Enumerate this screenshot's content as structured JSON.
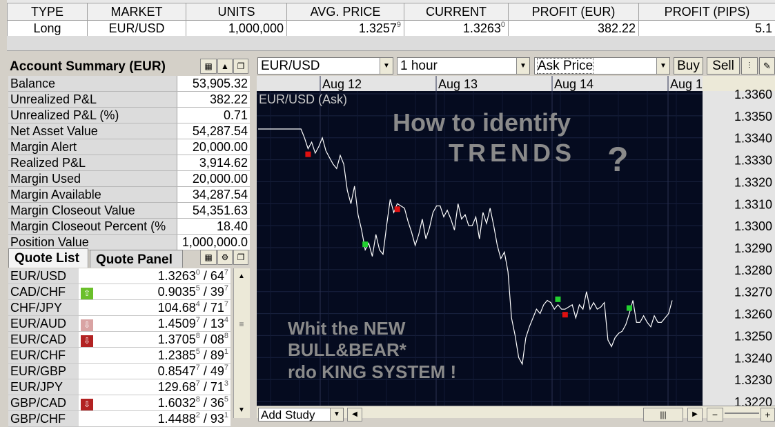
{
  "positions": {
    "headers": [
      "TYPE",
      "MARKET",
      "UNITS",
      "AVG. PRICE",
      "CURRENT",
      "PROFIT (EUR)",
      "PROFIT (PIPS)"
    ],
    "row": {
      "type": "Long",
      "market": "EUR/USD",
      "units": "1,000,000",
      "avg_price_main": "1.3257",
      "avg_price_sup": "9",
      "current_main": "1.3263",
      "current_sup": "0",
      "profit_eur": "382.22",
      "profit_pips": "5.1"
    }
  },
  "account_summary": {
    "title": "Account Summary (EUR)",
    "rows": [
      {
        "label": "Balance",
        "value": "53,905.32"
      },
      {
        "label": "Unrealized P&L",
        "value": "382.22"
      },
      {
        "label": "Unrealized P&L (%)",
        "value": "0.71"
      },
      {
        "label": "Net Asset Value",
        "value": "54,287.54"
      },
      {
        "label": "Margin Alert",
        "value": "20,000.00"
      },
      {
        "label": "Realized P&L",
        "value": "3,914.62"
      },
      {
        "label": "Margin Used",
        "value": "20,000.00"
      },
      {
        "label": "Margin Available",
        "value": "34,287.54"
      },
      {
        "label": "Margin Closeout Value",
        "value": "54,351.63"
      },
      {
        "label": "Margin Closeout Percent (%",
        "value": "18.40"
      },
      {
        "label": "Position Value",
        "value": "1,000,000.0"
      }
    ]
  },
  "quote": {
    "tab_list": "Quote List",
    "tab_panel": "Quote Panel",
    "rows": [
      {
        "symbol": "EUR/USD",
        "arrow": "",
        "bid": "1.3263",
        "bid_sup": "0",
        "ask": " / 64",
        "ask_sup": "7"
      },
      {
        "symbol": "CAD/CHF",
        "arrow": "up",
        "bid": "0.9035",
        "bid_sup": "5",
        "ask": " / 39",
        "ask_sup": "7"
      },
      {
        "symbol": "CHF/JPY",
        "arrow": "",
        "bid": "104.68",
        "bid_sup": "4",
        "ask": " / 71",
        "ask_sup": "7"
      },
      {
        "symbol": "EUR/AUD",
        "arrow": "down-light",
        "bid": "1.4509",
        "bid_sup": "7",
        "ask": " / 13",
        "ask_sup": "4"
      },
      {
        "symbol": "EUR/CAD",
        "arrow": "down",
        "bid": "1.3705",
        "bid_sup": "8",
        "ask": " / 08",
        "ask_sup": "8"
      },
      {
        "symbol": "EUR/CHF",
        "arrow": "",
        "bid": "1.2385",
        "bid_sup": "5",
        "ask": " / 89",
        "ask_sup": "1"
      },
      {
        "symbol": "EUR/GBP",
        "arrow": "",
        "bid": "0.8547",
        "bid_sup": "7",
        "ask": " / 49",
        "ask_sup": "7"
      },
      {
        "symbol": "EUR/JPY",
        "arrow": "",
        "bid": "129.68",
        "bid_sup": "7",
        "ask": " / 71",
        "ask_sup": "3"
      },
      {
        "symbol": "GBP/CAD",
        "arrow": "down",
        "bid": "1.6032",
        "bid_sup": "8",
        "ask": " / 36",
        "ask_sup": "5"
      },
      {
        "symbol": "GBP/CHF",
        "arrow": "",
        "bid": "1.4488",
        "bid_sup": "2",
        "ask": " / 93",
        "ask_sup": "1"
      }
    ]
  },
  "chart_toolbar": {
    "instrument": "EUR/USD",
    "timeframe": "1 hour",
    "price_type": "Ask Price",
    "buy": "Buy",
    "sell": "Sell",
    "add_study": "Add Study"
  },
  "chart_data": {
    "type": "line",
    "title": "EUR/USD (Ask)",
    "x_labels": [
      "Aug 12",
      "Aug 13",
      "Aug 14",
      "Aug 1"
    ],
    "y_ticks": [
      "1.3360",
      "1.3350",
      "1.3340",
      "1.3330",
      "1.3320",
      "1.3310",
      "1.3300",
      "1.3290",
      "1.3280",
      "1.3270",
      "1.3260",
      "1.3250",
      "1.3240",
      "1.3230",
      "1.3220"
    ],
    "ylim": [
      1.322,
      1.336
    ],
    "annotation_line1": "How to identify",
    "annotation_line2": "TRENDS",
    "annotation_mark": "?",
    "caption_line1": "Whit the NEW",
    "caption_line2": "BULL&BEAR*",
    "caption_line3": "rdo KING SYSTEM !",
    "series": [
      {
        "values": [
          1.3344,
          1.3344,
          1.3344,
          1.3344,
          1.3344,
          1.3344,
          1.3344,
          1.3344,
          1.3344,
          1.3344,
          1.3344,
          1.3344,
          1.3344,
          1.334,
          1.3335,
          1.3338,
          1.3333,
          1.3336,
          1.334,
          1.3334,
          1.3331,
          1.3328,
          1.3326,
          1.3332,
          1.3328,
          1.3316,
          1.331,
          1.3318,
          1.3305,
          1.3298,
          1.3289,
          1.3292,
          1.3286,
          1.3296,
          1.3289,
          1.3287,
          1.33,
          1.3312,
          1.3306,
          1.331,
          1.3309,
          1.3308,
          1.3302,
          1.3297,
          1.3291,
          1.3296,
          1.3303,
          1.3294,
          1.3299,
          1.3306,
          1.3309,
          1.3309,
          1.3304,
          1.3307,
          1.3303,
          1.3298,
          1.331,
          1.3303,
          1.3305,
          1.33,
          1.33,
          1.3304,
          1.3294,
          1.3306,
          1.3301,
          1.3308,
          1.33,
          1.3291,
          1.3285,
          1.3288,
          1.3279,
          1.3258,
          1.325,
          1.324,
          1.3237,
          1.3249,
          1.3254,
          1.3258,
          1.3262,
          1.326,
          1.3264,
          1.3266,
          1.3265,
          1.3262,
          1.3264,
          1.3262,
          1.3262,
          1.3263,
          1.3264,
          1.3258,
          1.3264,
          1.3262,
          1.327,
          1.3262,
          1.3265,
          1.3262,
          1.3263,
          1.3265,
          1.3248,
          1.3245,
          1.3249,
          1.3251,
          1.3252,
          1.3255,
          1.326,
          1.3266,
          1.3256,
          1.3256,
          1.3259,
          1.3256,
          1.3254,
          1.3259,
          1.3256,
          1.3256,
          1.3258,
          1.326,
          1.3266
        ]
      }
    ],
    "signals": [
      {
        "index": 14,
        "color": "red"
      },
      {
        "index": 30,
        "color": "green"
      },
      {
        "index": 39,
        "color": "red"
      },
      {
        "index": 84,
        "color": "green"
      },
      {
        "index": 86,
        "color": "red"
      },
      {
        "index": 104,
        "color": "green"
      }
    ]
  }
}
